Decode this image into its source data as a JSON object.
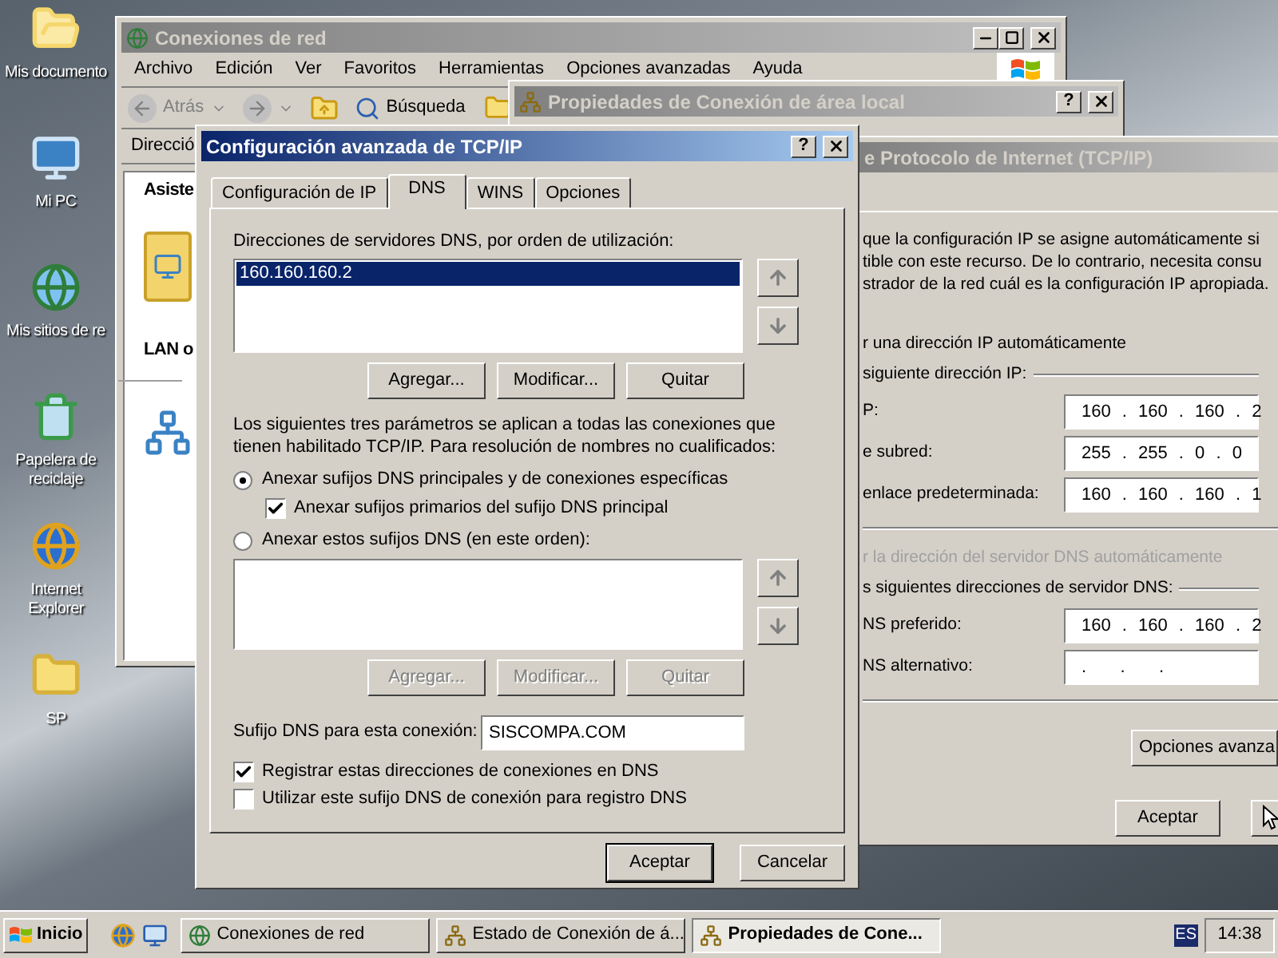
{
  "desktop": {
    "icons": [
      {
        "label": "Mis documento",
        "kind": "documents"
      },
      {
        "label": "Mi PC",
        "kind": "computer"
      },
      {
        "label": "Mis sitios de re",
        "kind": "network"
      },
      {
        "label": "Papelera de reciclaje",
        "kind": "recycle"
      },
      {
        "label": "Internet Explorer",
        "kind": "browser"
      },
      {
        "label": "SP",
        "kind": "folder"
      }
    ]
  },
  "network_window": {
    "title": "Conexiones de red",
    "active": false,
    "menu": [
      "Archivo",
      "Edición",
      "Ver",
      "Favoritos",
      "Herramientas",
      "Opciones avanzadas",
      "Ayuda"
    ],
    "back": "Atrás",
    "search": "Búsqueda",
    "address_label": "Direcció",
    "pane_header": "Asiste",
    "group_label": "LAN o"
  },
  "properties_window": {
    "title": "Propiedades de Conexión de área local",
    "active": false,
    "help": "?"
  },
  "tcpip_window": {
    "title": "e Protocolo de Internet (TCP/IP)",
    "active": false,
    "intro": [
      "que la configuración IP se asigne automáticamente si",
      "tible con este recurso. De lo contrario, necesita consu",
      "strador de la red cuál es la configuración IP apropiada."
    ],
    "rows": [
      {
        "kind": "option",
        "label": "r una dirección IP automáticamente",
        "disabled": false
      },
      {
        "kind": "group",
        "label": "siguiente dirección IP:"
      },
      {
        "kind": "field",
        "label": "P:",
        "value": "160 . 160 . 160 . 2"
      },
      {
        "kind": "field",
        "label": "e subred:",
        "value": "255 . 255 . 0 . 0"
      },
      {
        "kind": "field",
        "label": "enlace predeterminada:",
        "value": "160 . 160 . 160 . 1"
      },
      {
        "kind": "separator"
      },
      {
        "kind": "option",
        "label": "r la dirección del servidor DNS automáticamente",
        "disabled": true
      },
      {
        "kind": "group",
        "label": "s siguientes direcciones de servidor DNS:"
      },
      {
        "kind": "field",
        "label": "NS preferido:",
        "value": "160 . 160 . 160 . 2"
      },
      {
        "kind": "field",
        "label": "NS alternativo:",
        "value": ".   .   ."
      },
      {
        "kind": "separator"
      }
    ],
    "advanced_button": "Opciones avanza",
    "ok_button": "Aceptar"
  },
  "dialog": {
    "title": "Configuración avanzada de TCP/IP",
    "active": true,
    "help": "?",
    "tabs": [
      {
        "label": "Configuración de IP",
        "selected": false
      },
      {
        "label": "DNS",
        "selected": true
      },
      {
        "label": "WINS",
        "selected": false
      },
      {
        "label": "Opciones",
        "selected": false
      }
    ],
    "servers_label": "Direcciones de servidores DNS, por orden de utilización:",
    "servers": [
      {
        "address": "160.160.160.2",
        "selected": true
      }
    ],
    "server_buttons": [
      {
        "label": "Agregar...",
        "disabled": false
      },
      {
        "label": "Modificar...",
        "disabled": false
      },
      {
        "label": "Quitar",
        "disabled": false
      }
    ],
    "note_lines": [
      "Los siguientes tres parámetros se aplican a todas las conexiones que",
      "tienen habilitado TCP/IP. Para resolución de nombres no cualificados:"
    ],
    "suffix_options": [
      {
        "label": "Anexar sufijos DNS principales y de conexiones específicas",
        "selected": true,
        "children": [
          {
            "label": "Anexar sufijos primarios del sufijo DNS principal",
            "checked": true
          }
        ]
      },
      {
        "label": "Anexar estos sufijos DNS (en este orden):",
        "selected": false
      }
    ],
    "suffix_buttons": [
      {
        "label": "Agregar...",
        "disabled": true
      },
      {
        "label": "Modificar...",
        "disabled": true
      },
      {
        "label": "Quitar",
        "disabled": true
      }
    ],
    "connection_suffix": {
      "label": "Sufijo DNS para esta conexión:",
      "value": "SISCOMPA.COM"
    },
    "registration": [
      {
        "label": "Registrar estas direcciones de conexiones en DNS",
        "checked": true
      },
      {
        "label": "Utilizar este sufijo DNS de conexión para registro DNS",
        "checked": false
      }
    ],
    "buttons": [
      {
        "label": "Aceptar",
        "default": true
      },
      {
        "label": "Cancelar",
        "default": false
      }
    ]
  },
  "taskbar": {
    "start": "Inicio",
    "tasks": [
      {
        "label": "Conexiones de red",
        "kind": "network",
        "selected": false
      },
      {
        "label": "Estado de Conexión de á...",
        "kind": "connection",
        "selected": false
      },
      {
        "label": "Propiedades de Cone...",
        "kind": "connection",
        "selected": true
      }
    ],
    "language": "ES",
    "clock": "14:38"
  }
}
